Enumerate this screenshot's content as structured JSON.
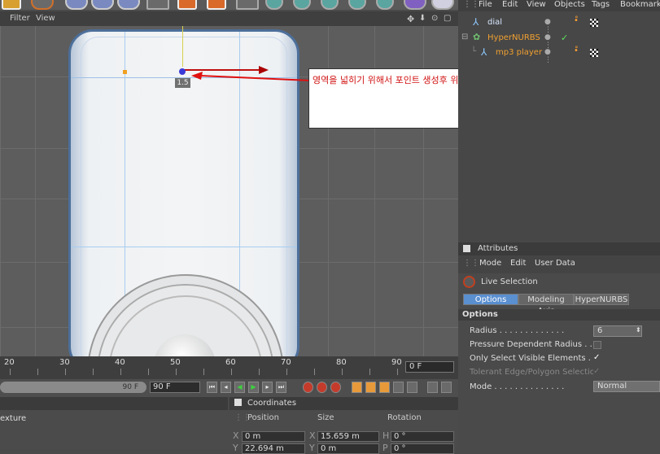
{
  "viewport": {
    "menu": [
      "Filter",
      "View"
    ],
    "point_label": "1.5"
  },
  "callout": {
    "text": "영역을 넓히기 위해서 포인트 생성후 위로 위치 이동"
  },
  "timeline": {
    "ticks": [
      "20",
      "30",
      "40",
      "50",
      "60",
      "70",
      "80",
      "90"
    ],
    "current_frame": "0 F"
  },
  "transport": {
    "slider_value": "90 F",
    "end_frame": "90 F"
  },
  "bottom_left": {
    "texture_label": "exture"
  },
  "coordinates": {
    "title": "Coordinates",
    "col_position": "Position",
    "col_size": "Size",
    "col_rotation": "Rotation",
    "row1_axis": "X",
    "row1_position": "0 m",
    "row1_size_axis": "X",
    "row1_size": "15.659 m",
    "row1_rot_axis": "H",
    "row1_rotation": "0 °",
    "row2_axis": "Y",
    "row2_position": "22.694 m",
    "row2_size_axis": "Y",
    "row2_size": "0 m",
    "row2_rot_axis": "P",
    "row2_rotation": "0 °"
  },
  "object_manager": {
    "menu": [
      "File",
      "Edit",
      "View",
      "Objects",
      "Tags",
      "Bookmarks"
    ],
    "objects": [
      {
        "name": "dial",
        "color": "#cfe7ff"
      },
      {
        "name": "HyperNURBS",
        "color": "#f0a030"
      },
      {
        "name": "mp3 player",
        "color": "#f0a030"
      }
    ]
  },
  "attributes": {
    "title": "Attributes",
    "menu": [
      "Mode",
      "Edit",
      "User Data"
    ],
    "tool_name": "Live Selection",
    "tabs": [
      "Options",
      "Modeling Axis",
      "HyperNURBS"
    ],
    "section": "Options",
    "radius_label": "Radius . . . . . . . . . . . . .",
    "radius_value": "6",
    "pressure_label": "Pressure Dependent Radius . .",
    "visible_label": "Only Select Visible Elements . . .",
    "tolerant_label": "Tolerant Edge/Polygon Selection",
    "mode_label": "Mode . . . . . . . . . . . . . .",
    "mode_value": "Normal"
  }
}
